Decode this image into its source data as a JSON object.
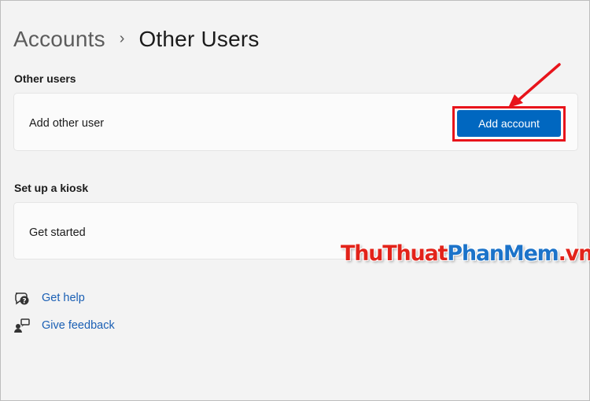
{
  "breadcrumb": {
    "parent": "Accounts",
    "separator": "›",
    "current": "Other Users"
  },
  "other_users": {
    "section_title": "Other users",
    "row_label": "Add other user",
    "button_label": "Add account"
  },
  "kiosk": {
    "section_title": "Set up a kiosk",
    "row_label": "Get started"
  },
  "links": {
    "help_label": "Get help",
    "help_icon": "help-chat-icon",
    "feedback_label": "Give feedback",
    "feedback_icon": "feedback-icon"
  },
  "watermark": {
    "part1": "ThuThuat",
    "part2": "PhanMem",
    "part3": ".vn"
  },
  "colors": {
    "accent": "#0067c0",
    "highlight": "#e8141b",
    "link": "#1a5fb4",
    "background": "#f3f3f3",
    "card": "#fbfbfb"
  }
}
